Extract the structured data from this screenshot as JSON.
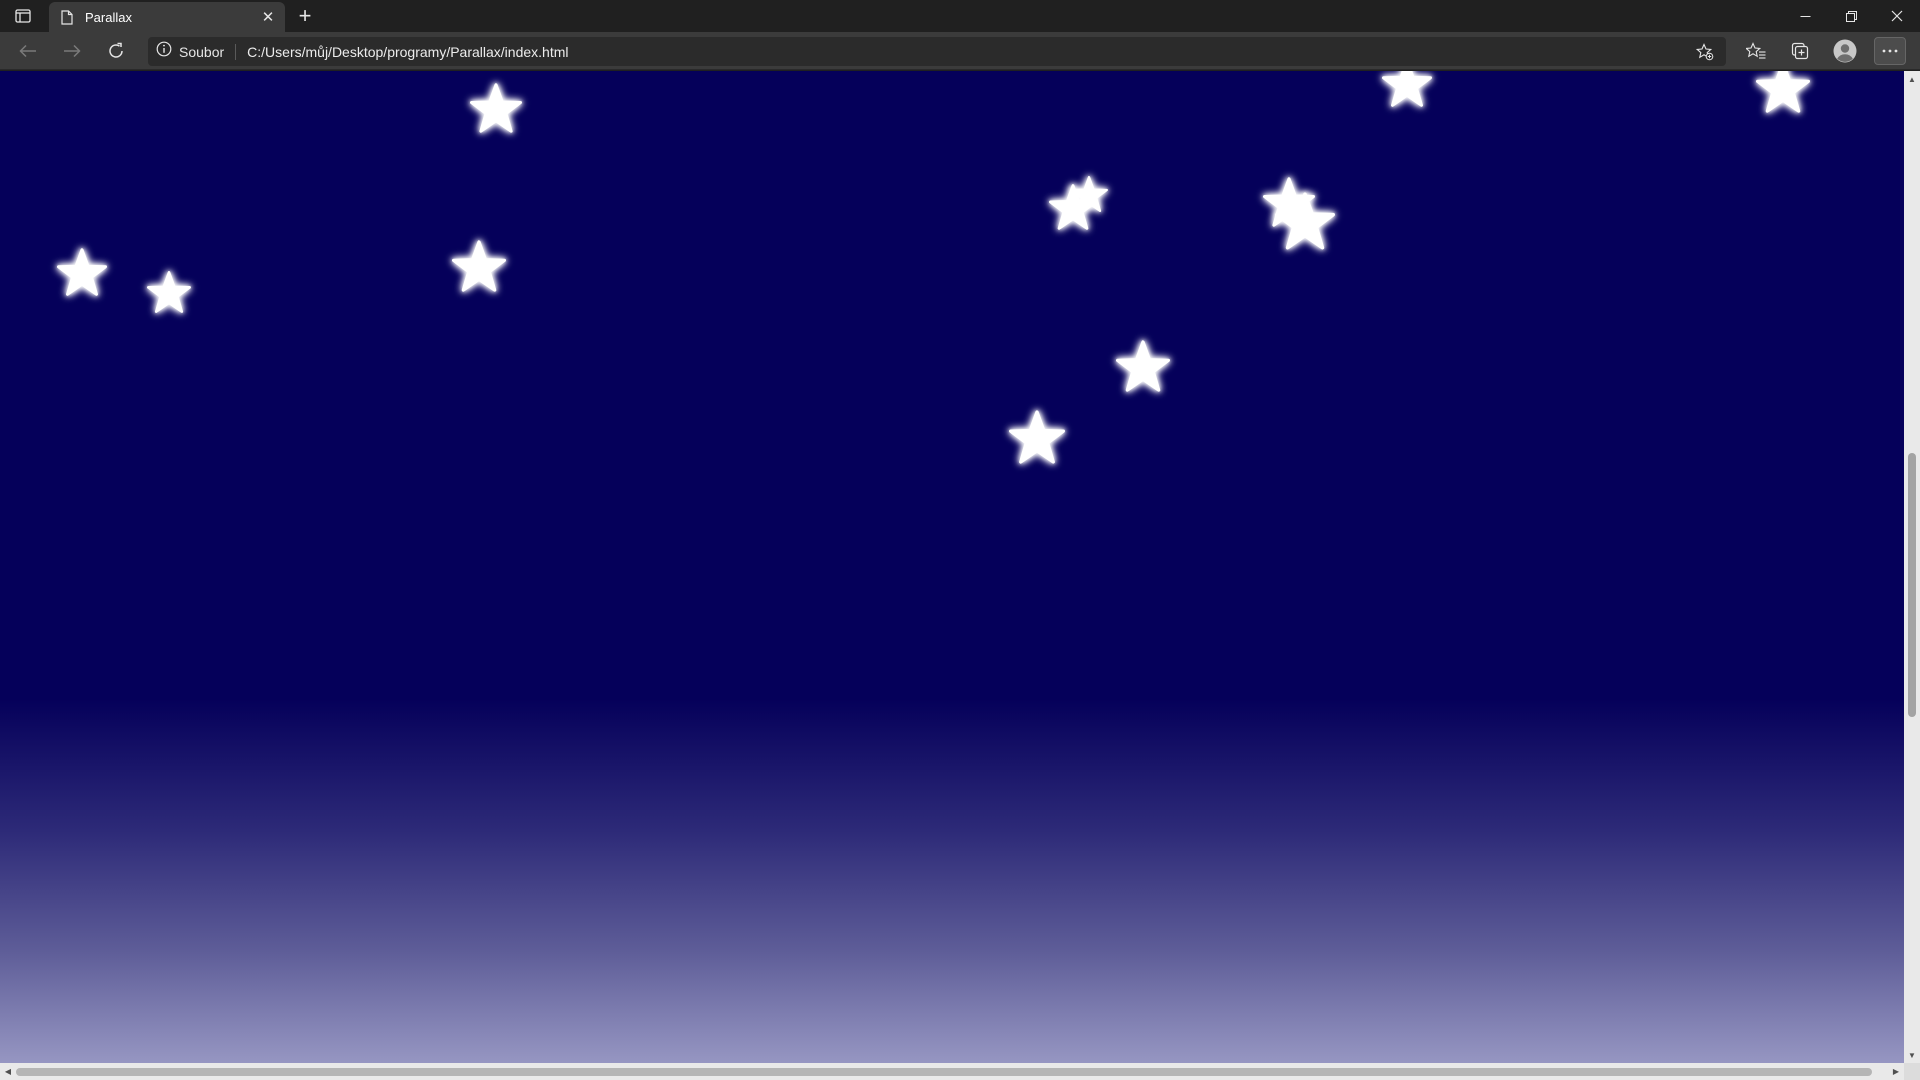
{
  "browser": {
    "tab": {
      "title": "Parallax",
      "close": "✕",
      "favicon": "page-icon"
    },
    "new_tab": "+",
    "window_controls": {
      "minimize": "─",
      "restore": "❐",
      "close": "✕"
    },
    "site_info_label": "Soubor",
    "url": "C:/Users/můj/Desktop/programy/Parallax/index.html",
    "toolbar_icons": [
      "add-favorite-icon",
      "favorites-icon",
      "collections-icon",
      "profile-icon",
      "more-icon"
    ]
  },
  "page": {
    "background_colors": {
      "sky": "#05005a",
      "horizon": "#9696c2"
    },
    "star_color": "#ffffff",
    "star_count": 13
  },
  "scrollbars": {
    "up_arrow": "▲",
    "down_arrow": "▼",
    "left_arrow": "◀",
    "right_arrow": "▶"
  }
}
